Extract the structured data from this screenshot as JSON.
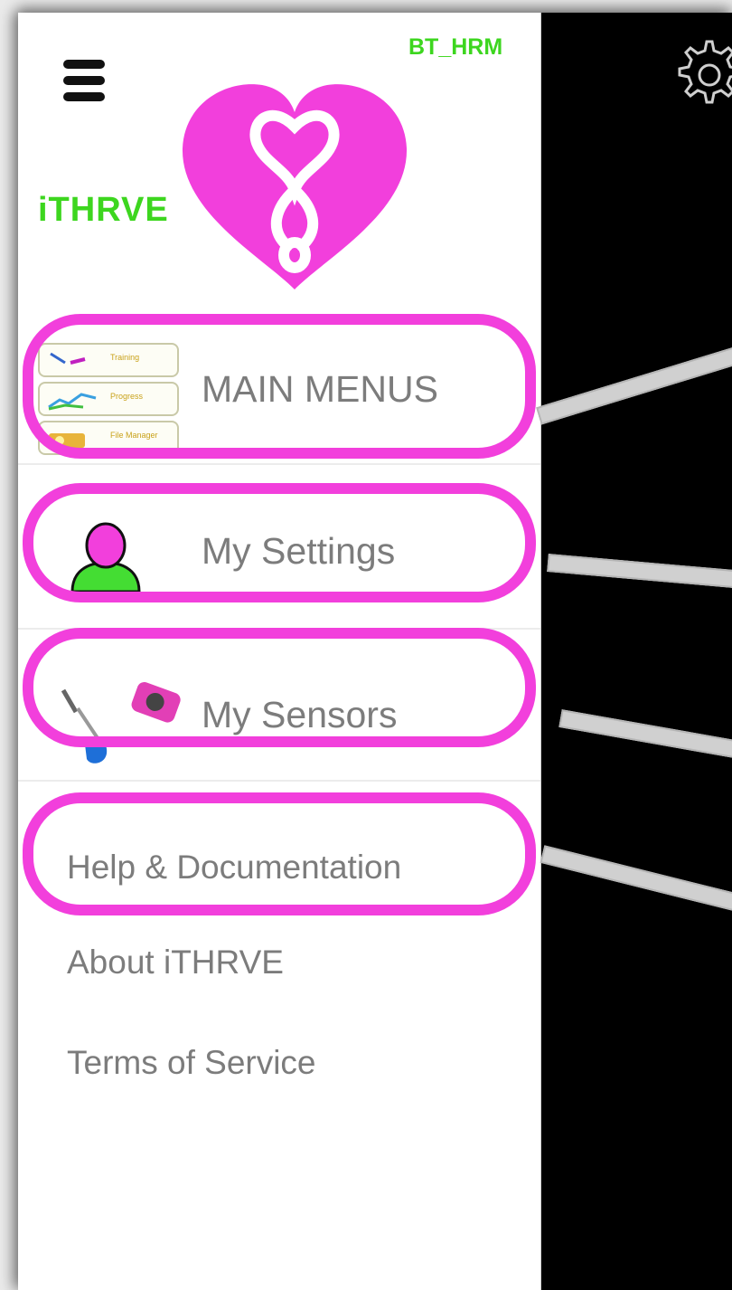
{
  "app": {
    "name": "iTHRVE",
    "connection_status": "BT_HRM"
  },
  "menu": {
    "main_menus": {
      "label": "MAIN MENUS",
      "icon": "main-menus-thumbnail-icon",
      "sub_cards": [
        "Training",
        "Progress",
        "File Manager"
      ]
    },
    "my_settings": {
      "label": "My Settings",
      "icon": "user-profile-icon"
    },
    "my_sensors": {
      "label": "My Sensors",
      "icon": "sensors-icon"
    },
    "help": {
      "label": "Help & Documentation"
    },
    "about": {
      "label": "About iTHRVE"
    },
    "terms": {
      "label": "Terms of Service"
    }
  },
  "header": {
    "menu_icon": "hamburger-icon",
    "settings_icon": "gear-icon"
  },
  "colors": {
    "brand_magenta": "#f23fdc",
    "brand_green": "#3dd61f",
    "text_gray": "#7c7c7c",
    "background_dark": "#000000"
  }
}
